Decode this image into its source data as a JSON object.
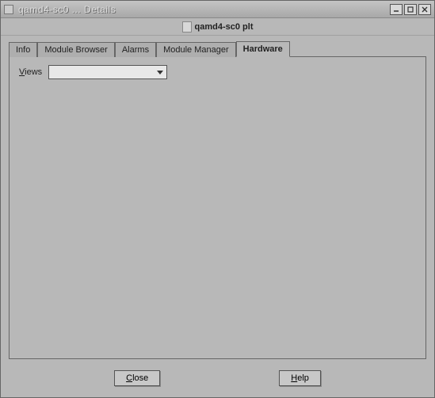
{
  "window": {
    "title": "qamd4-sc0 ... Details"
  },
  "header": {
    "title": "qamd4-sc0 plt"
  },
  "tabs": [
    {
      "label": "Info",
      "active": false
    },
    {
      "label": "Module Browser",
      "active": false
    },
    {
      "label": "Alarms",
      "active": false
    },
    {
      "label": "Module Manager",
      "active": false
    },
    {
      "label": "Hardware",
      "active": true
    }
  ],
  "hardware": {
    "views_label": "Views",
    "views_value": ""
  },
  "buttons": {
    "close": "Close",
    "help": "Help"
  }
}
